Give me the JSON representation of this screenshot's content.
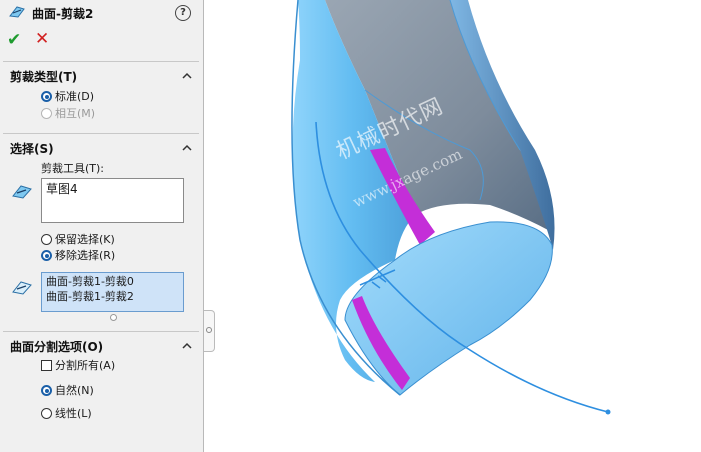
{
  "feature": {
    "title": "曲面-剪裁2",
    "icon": "surface-trim-icon",
    "help": "?"
  },
  "actions": {
    "ok": "✔",
    "cancel": "✕"
  },
  "trim_type": {
    "title": "剪裁类型(T)",
    "options": [
      {
        "label": "标准(D)",
        "selected": true,
        "enabled": true
      },
      {
        "label": "相互(M)",
        "selected": false,
        "enabled": false
      }
    ]
  },
  "selection": {
    "title": "选择(S)",
    "trim_tool_label": "剪裁工具(T):",
    "trim_tool_value": "草图4",
    "options": [
      {
        "label": "保留选择(K)",
        "selected": false
      },
      {
        "label": "移除选择(R)",
        "selected": true
      }
    ],
    "selected_items": [
      "曲面-剪裁1-剪裁0",
      "曲面-剪裁1-剪裁2"
    ]
  },
  "split_options": {
    "title": "曲面分割选项(O)",
    "split_all": {
      "label": "分割所有(A)",
      "checked": false
    },
    "options": [
      {
        "label": "自然(N)",
        "selected": true
      },
      {
        "label": "线性(L)",
        "selected": false
      }
    ]
  },
  "watermark": {
    "line1": "机械时代网",
    "line2": "www.jxage.com"
  },
  "colors": {
    "accent": "#1a5fa8",
    "surface": "#6fc3f5",
    "highlight": "#c42ed8",
    "ok": "#1f9b2f",
    "cancel": "#d12020"
  }
}
